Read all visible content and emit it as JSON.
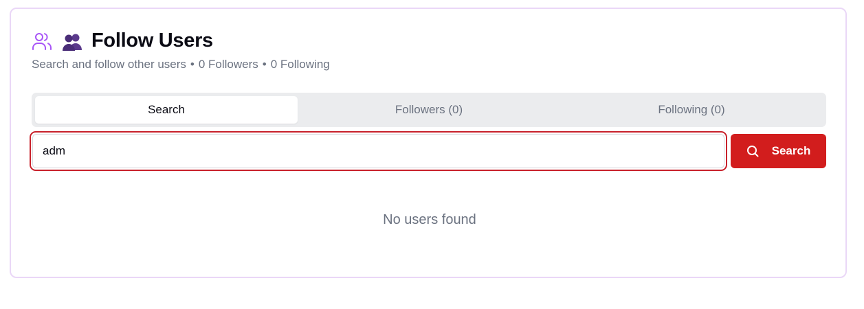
{
  "header": {
    "title": "Follow Users",
    "subtitle_prefix": "Search and follow other users",
    "separator": "•",
    "followers_text": "0 Followers",
    "following_text": "0 Following"
  },
  "tabs": [
    {
      "label": "Search",
      "active": true
    },
    {
      "label": "Followers (0)",
      "active": false
    },
    {
      "label": "Following (0)",
      "active": false
    }
  ],
  "search": {
    "value": "adm",
    "button_label": "Search"
  },
  "results": {
    "empty_text": "No users found"
  },
  "colors": {
    "accent_purple": "#a855f7",
    "primary_red": "#d21d1d",
    "focus_ring": "#c8212b",
    "card_border": "#ead7f7"
  },
  "icons": {
    "header_outline": "users-icon",
    "header_emoji": "busts-in-silhouette-icon",
    "search_button": "search-icon"
  }
}
